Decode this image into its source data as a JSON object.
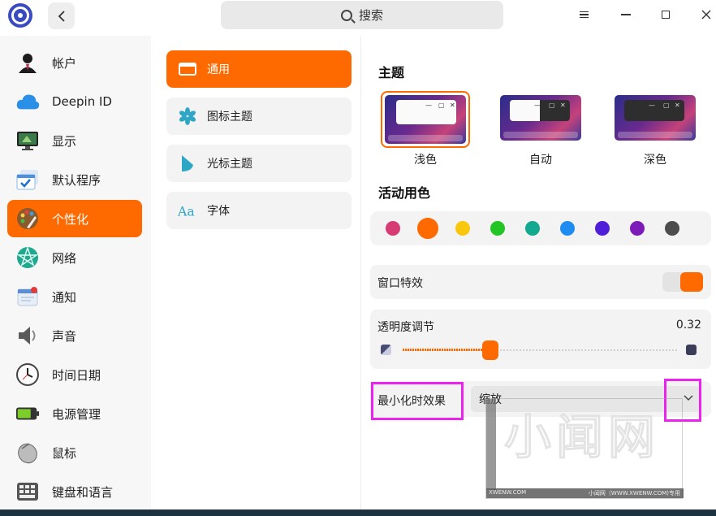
{
  "titlebar": {
    "search_placeholder": "搜索"
  },
  "sidebar": {
    "items": [
      {
        "label": "帐户",
        "icon": "account-icon"
      },
      {
        "label": "Deepin ID",
        "icon": "cloud-icon"
      },
      {
        "label": "显示",
        "icon": "display-icon"
      },
      {
        "label": "默认程序",
        "icon": "default-apps-icon"
      },
      {
        "label": "个性化",
        "icon": "personalization-icon",
        "active": true
      },
      {
        "label": "网络",
        "icon": "network-icon"
      },
      {
        "label": "通知",
        "icon": "notification-icon"
      },
      {
        "label": "声音",
        "icon": "sound-icon"
      },
      {
        "label": "时间日期",
        "icon": "clock-icon"
      },
      {
        "label": "电源管理",
        "icon": "battery-icon"
      },
      {
        "label": "鼠标",
        "icon": "mouse-icon"
      },
      {
        "label": "键盘和语言",
        "icon": "keyboard-icon"
      }
    ]
  },
  "submenu": {
    "items": [
      {
        "label": "通用",
        "icon": "window-icon",
        "active": true
      },
      {
        "label": "图标主题",
        "icon": "icon-theme-icon"
      },
      {
        "label": "光标主题",
        "icon": "cursor-icon"
      },
      {
        "label": "字体",
        "icon": "font-icon"
      }
    ]
  },
  "main": {
    "theme_title": "主题",
    "themes": [
      {
        "label": "浅色",
        "selected": true
      },
      {
        "label": "自动",
        "selected": false
      },
      {
        "label": "深色",
        "selected": false
      }
    ],
    "accent_title": "活动用色",
    "accent_colors": [
      "#d63c73",
      "#ff6a00",
      "#f9c80e",
      "#22c523",
      "#13a88f",
      "#1e8cf0",
      "#4e1ed9",
      "#7c1bb8",
      "#4d4d4d"
    ],
    "accent_selected_index": 1,
    "window_effects_label": "窗口特效",
    "window_effects_on": true,
    "transparency_label": "透明度调节",
    "transparency_value": "0.32",
    "transparency_fraction": 0.32,
    "minimize_label": "最小化时效果",
    "minimize_value": "缩放"
  },
  "colors": {
    "accent": "#ff6a00",
    "highlight": "#ee22ee"
  },
  "watermark": {
    "big": "小闻网",
    "url": "XWENW.COM",
    "bar_left": "XWENW.COM",
    "bar_right": "小闻网（WWW.XWENW.COM)专用",
    "side": "XWENW.COM"
  }
}
